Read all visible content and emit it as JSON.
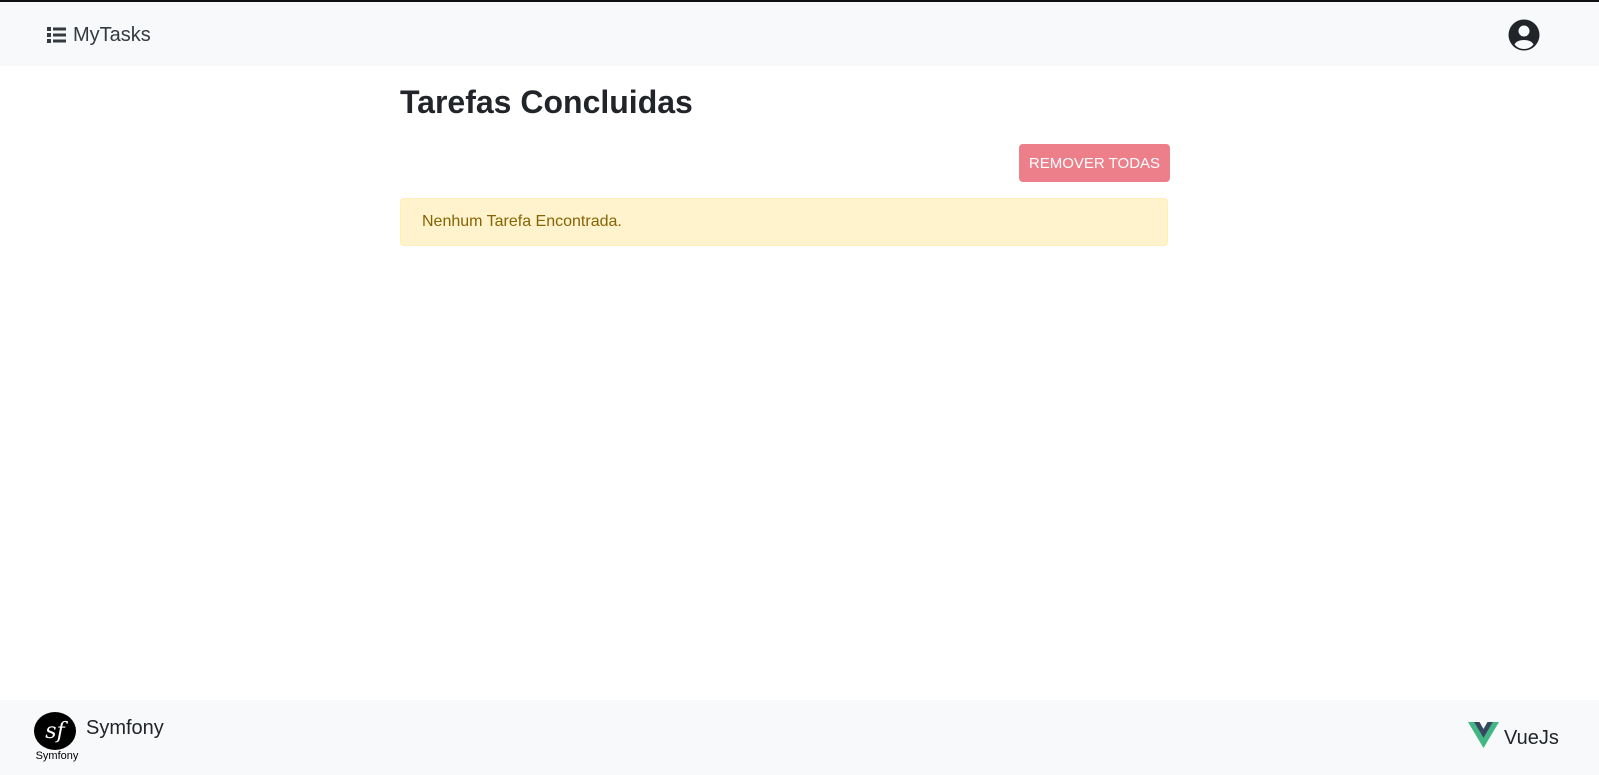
{
  "navbar": {
    "brand_label": "MyTasks",
    "brand_icon": "list-icon",
    "user_icon": "user-circle-icon"
  },
  "main": {
    "title": "Tarefas Concluidas",
    "remove_all_label": "REMOVER TODAS",
    "empty_message": "Nenhum Tarefa Encontrada."
  },
  "footer": {
    "symfony_logo_text": "sf",
    "symfony_logo_caption": "Symfony",
    "symfony_label": "Symfony",
    "vue_label": "VueJs"
  },
  "colors": {
    "navbar_bg": "#f8f9fa",
    "danger_button": "#ec7f8a",
    "alert_bg": "#fff3cd",
    "alert_text": "#856404",
    "vue_green": "#41b883",
    "vue_dark": "#35495e"
  }
}
